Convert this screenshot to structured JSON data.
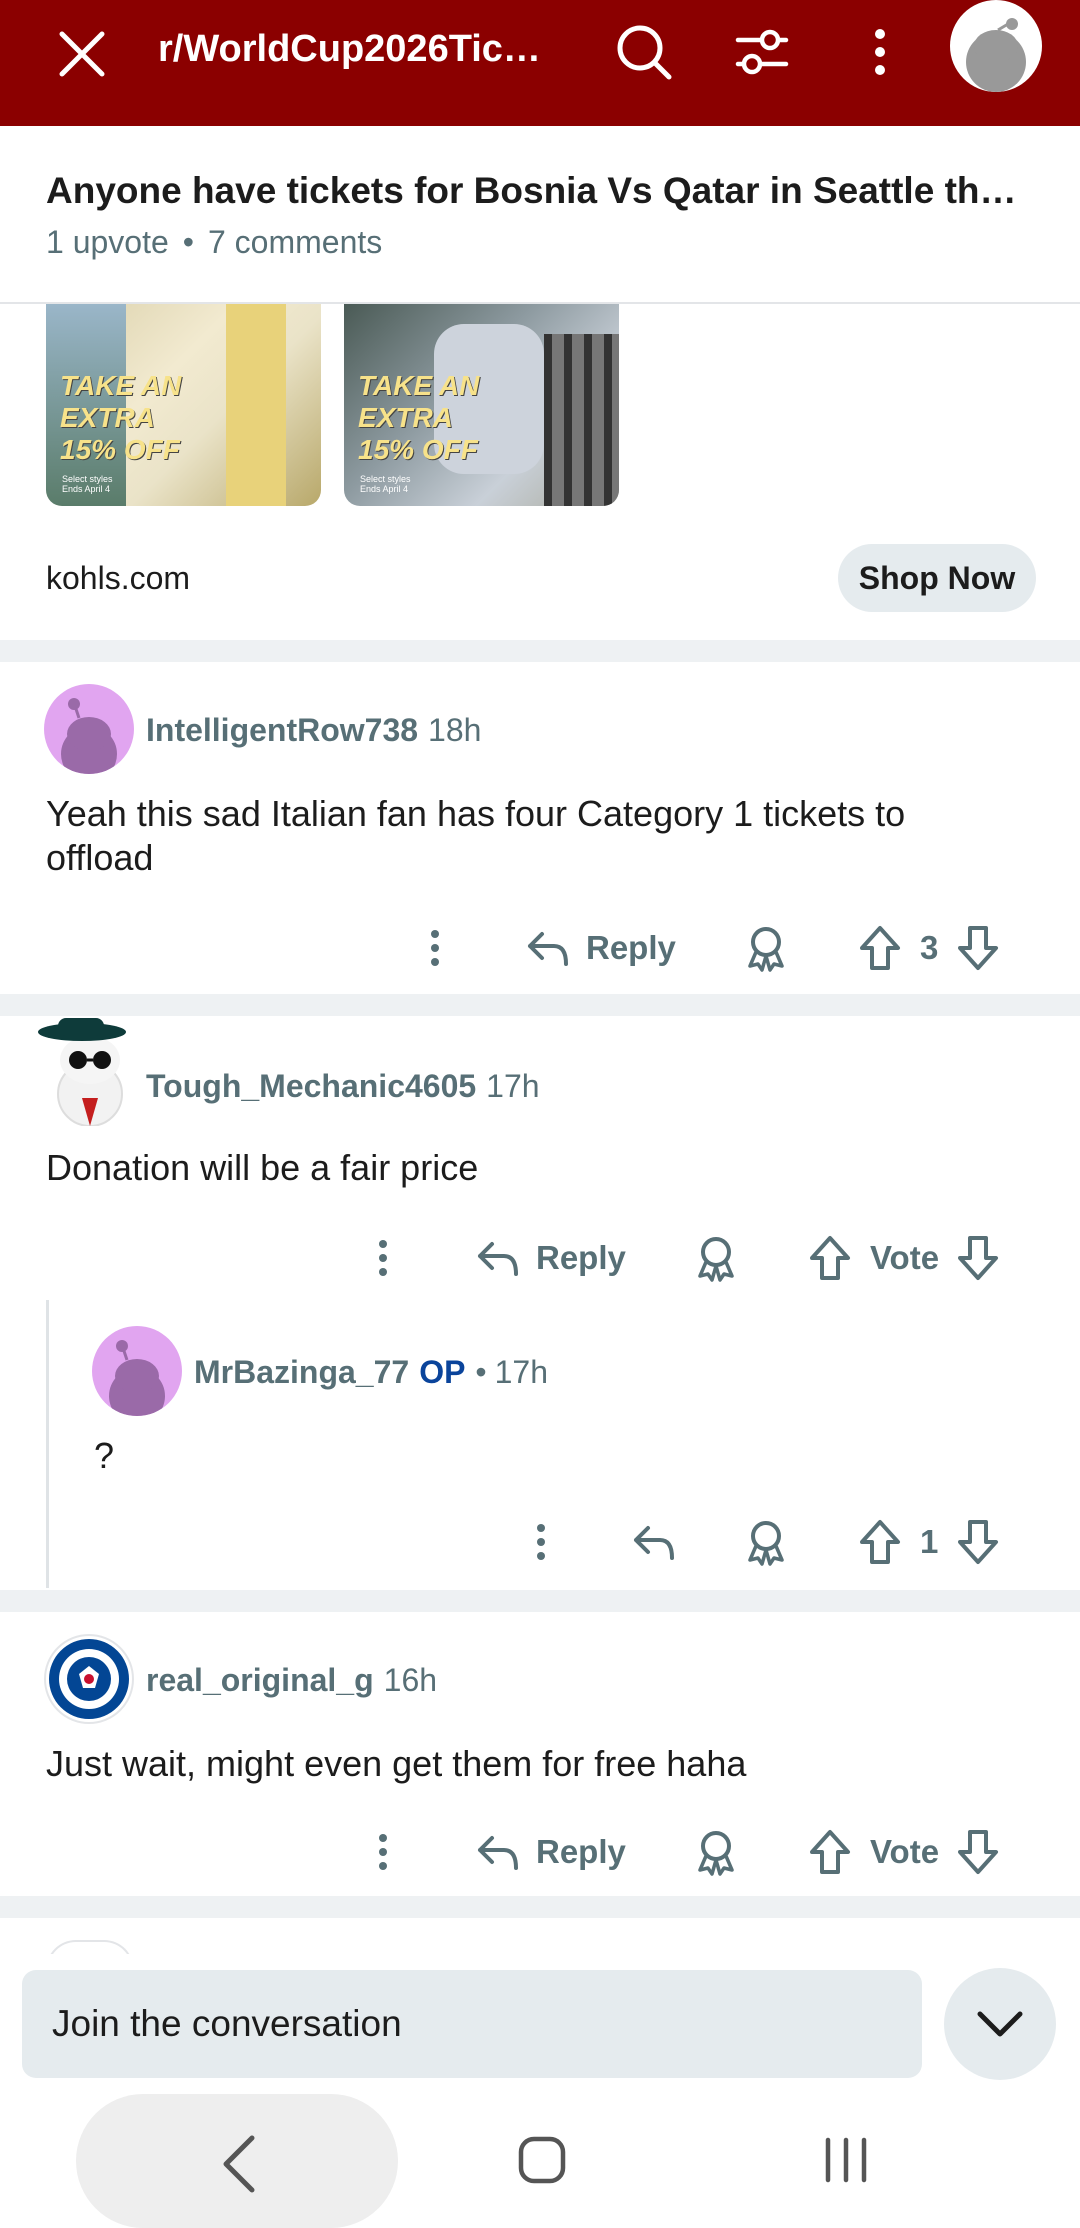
{
  "colors": {
    "brand": "#8b0000",
    "meta": "#576f76",
    "op": "#0a449b",
    "pill": "#e5ebee"
  },
  "topbar": {
    "title": "r/WorldCup2026Tick…",
    "icons": [
      "close-icon",
      "search-icon",
      "filter-icon",
      "more-icon",
      "avatar"
    ]
  },
  "post": {
    "title": "Anyone have tickets for Bosnia Vs Qatar in Seattle the…",
    "upvotes": "1 upvote",
    "separator": "•",
    "comments": "7 comments"
  },
  "ad": {
    "images": [
      {
        "promo_line1": "TAKE AN",
        "promo_line2": "EXTRA",
        "promo_line3": "15% OFF",
        "fine1": "Select styles",
        "fine2": "Ends April 4"
      },
      {
        "promo_line1": "TAKE AN",
        "promo_line2": "EXTRA",
        "promo_line3": "15% OFF",
        "fine1": "Select styles",
        "fine2": "Ends April 4"
      }
    ],
    "source": "kohls.com",
    "cta": "Shop Now"
  },
  "comments": [
    {
      "user": "IntelligentRow738",
      "time": "18h",
      "body_line1": "Yeah this sad Italian fan has four Category 1 tickets to",
      "body_line2": "offload",
      "reply": "Reply",
      "score": "3"
    },
    {
      "user": "Tough_Mechanic4605",
      "time": "17h",
      "body_line1": "Donation will be a fair price",
      "reply": "Reply",
      "score": "Vote"
    },
    {
      "user": "MrBazinga_77",
      "op": "OP",
      "dot": "•",
      "time": "17h",
      "body_line1": "?",
      "score": "1"
    },
    {
      "user": "real_original_g",
      "time": "16h",
      "body_line1": "Just wait, might even get them for free haha",
      "reply": "Reply",
      "score": "Vote"
    }
  ],
  "composer": {
    "placeholder": "Join the conversation"
  }
}
